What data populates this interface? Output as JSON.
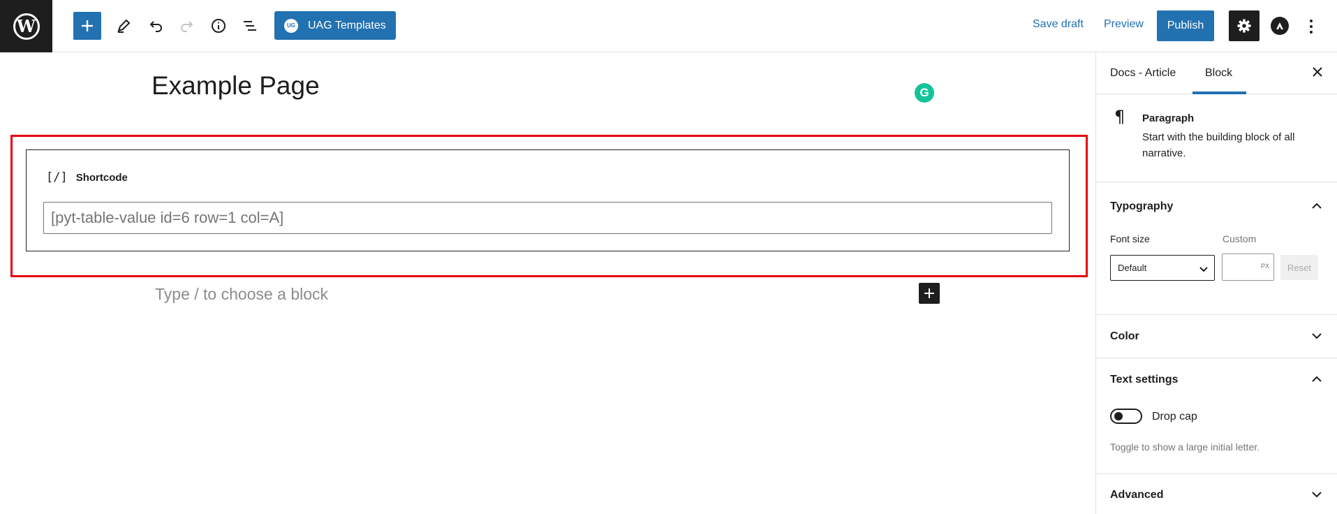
{
  "toolbar": {
    "wp_logo": "W",
    "uag_logo_text": "UG",
    "uag_label": "UAG Templates",
    "save_draft": "Save draft",
    "preview": "Preview",
    "publish": "Publish",
    "accent_color": "#2271b1"
  },
  "editor": {
    "title": "Example Page",
    "grammarly_letter": "G",
    "shortcode": {
      "icon": "[/]",
      "label": "Shortcode",
      "value": "[pyt-table-value id=6 row=1 col=A]"
    },
    "placeholder": "Type / to choose a block",
    "highlight_color": "#e5000f"
  },
  "sidebar": {
    "tabs": [
      "Docs - Article",
      "Block"
    ],
    "active_tab": "Block",
    "block": {
      "icon": "¶",
      "name": "Paragraph",
      "description": "Start with the building block of all narrative."
    },
    "typography": {
      "title": "Typography",
      "font_size_label": "Font size",
      "custom_label": "Custom",
      "font_size_value": "Default",
      "custom_unit": "PX",
      "reset": "Reset"
    },
    "color": {
      "title": "Color"
    },
    "text_settings": {
      "title": "Text settings",
      "drop_cap_label": "Drop cap",
      "drop_cap_help": "Toggle to show a large initial letter.",
      "drop_cap_enabled": false
    },
    "advanced": {
      "title": "Advanced"
    }
  }
}
